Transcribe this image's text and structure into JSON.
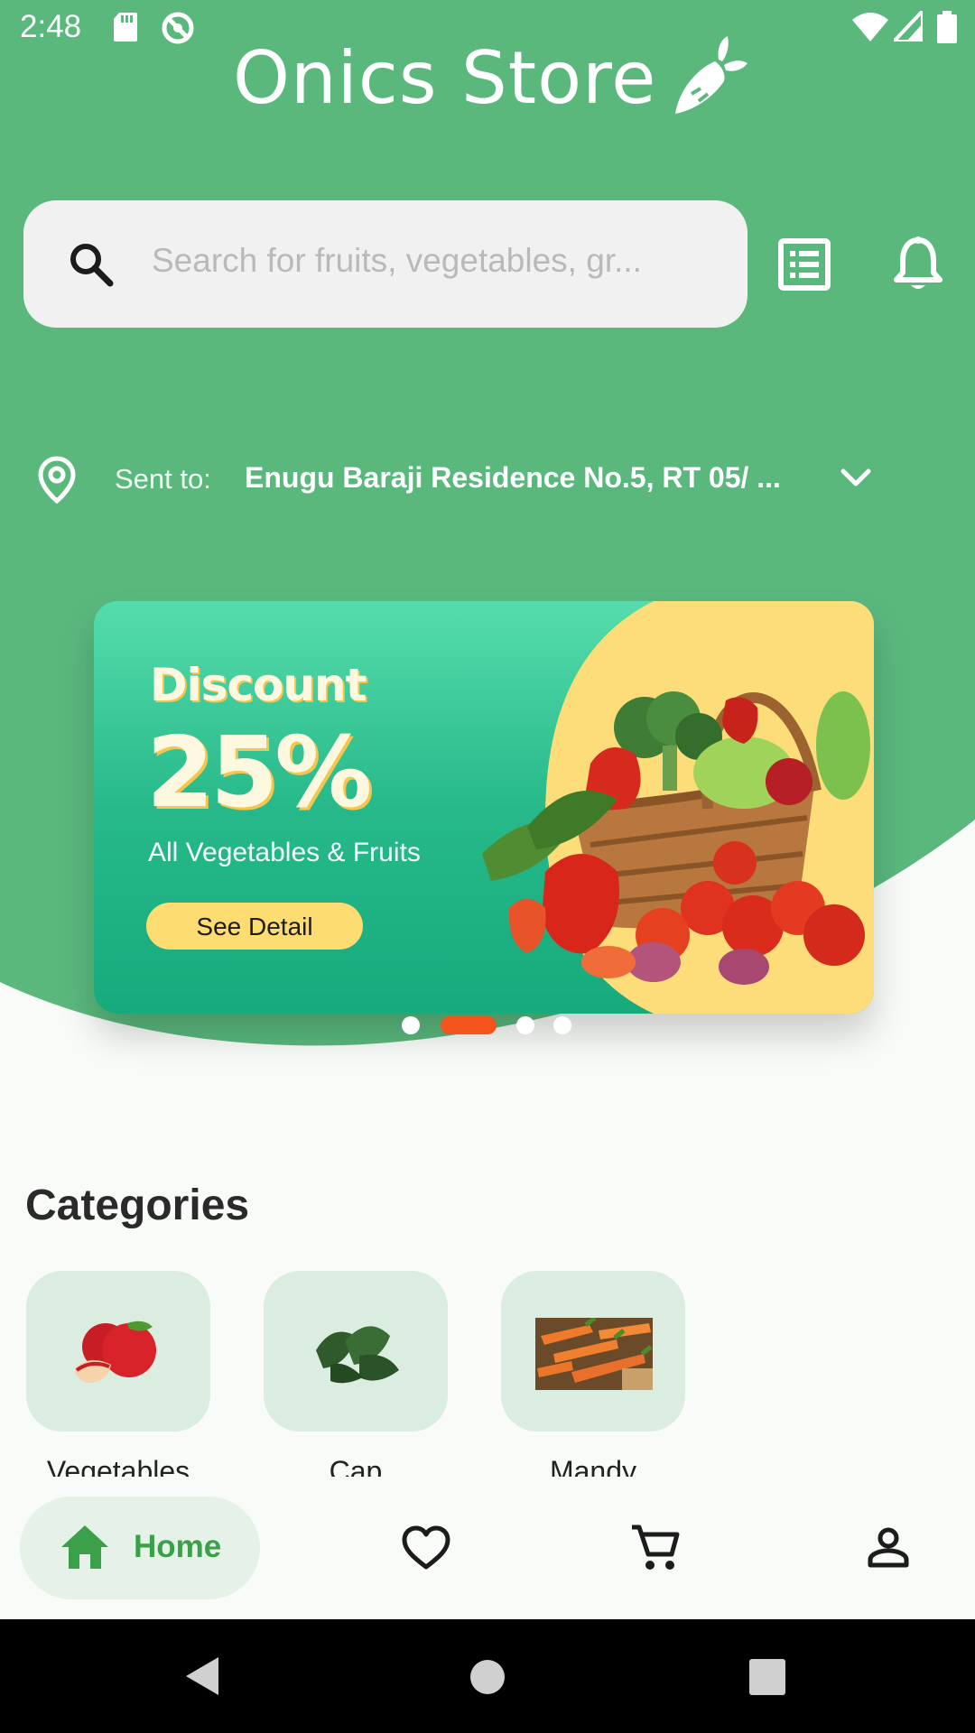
{
  "status_bar": {
    "time": "2:48"
  },
  "header": {
    "title": "Onics Store"
  },
  "search": {
    "placeholder": "Search for fruits, vegetables, gr..."
  },
  "location": {
    "label": "Sent to:",
    "address": "Enugu Baraji Residence No.5, RT 05/ ..."
  },
  "banner": {
    "title": "Discount",
    "value": "25%",
    "subtitle": "All Vegetables & Fruits",
    "button_label": "See Detail"
  },
  "carousel": {
    "total": 4,
    "active_index": 1
  },
  "categories": {
    "heading": "Categories",
    "items": [
      {
        "label": "Vegetables",
        "icon": "apple-image"
      },
      {
        "label": "Cap",
        "icon": "spinach-image"
      },
      {
        "label": "Mandy",
        "icon": "carrots-image"
      }
    ]
  },
  "bottom_nav": {
    "home_label": "Home",
    "items": [
      "home-icon",
      "heart-icon",
      "cart-icon",
      "profile-icon"
    ]
  },
  "colors": {
    "primary_green": "#5ab87d",
    "accent_orange": "#f2541c",
    "nav_active": "#3aa04a"
  }
}
